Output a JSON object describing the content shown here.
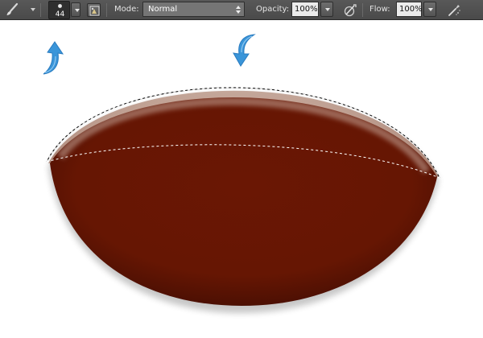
{
  "app": "Photoshop",
  "options_bar": {
    "tool_icon": "brush-tool-icon",
    "brush_size": "44",
    "mode_label": "Mode:",
    "mode_value": "Normal",
    "opacity_label": "Opacity:",
    "opacity_value": "100%",
    "flow_label": "Flow:",
    "flow_value": "100%",
    "icons": [
      "brush-tool-icon",
      "brush-panel-icon",
      "pressure-opacity-icon",
      "airbrush-icon"
    ]
  },
  "canvas": {
    "annotation_color": "#3a95d9",
    "ball_color": "#6a1704",
    "highlight_color": "#b99688",
    "selection_style": "marching-ants"
  }
}
